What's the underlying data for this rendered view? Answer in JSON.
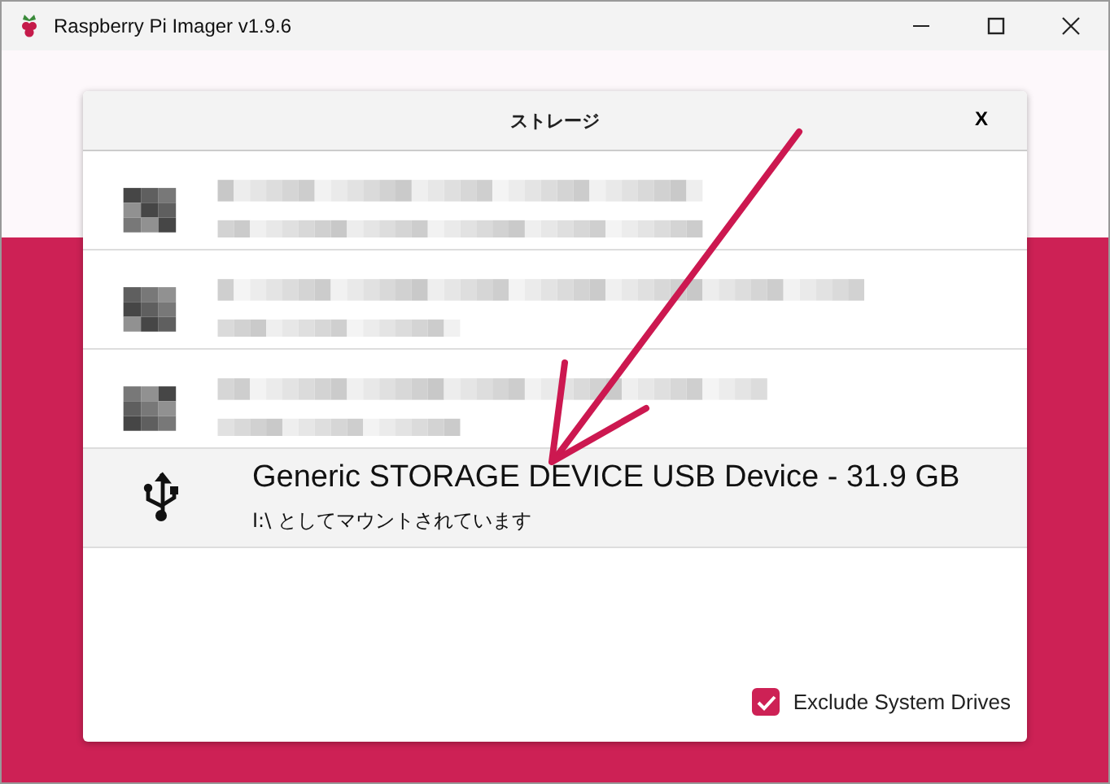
{
  "window": {
    "title": "Raspberry Pi Imager v1.9.6"
  },
  "dialog": {
    "title": "ストレージ",
    "close": "X",
    "drives": [
      {
        "kind": "redacted",
        "selected": false
      },
      {
        "kind": "redacted",
        "selected": false
      },
      {
        "kind": "redacted",
        "selected": false
      },
      {
        "kind": "device",
        "name": "Generic STORAGE DEVICE USB Device - 31.9 GB",
        "mount": "I:\\ としてマウントされています",
        "selected": true
      }
    ],
    "exclude_system_drives": {
      "label": "Exclude System Drives",
      "checked": true
    }
  }
}
